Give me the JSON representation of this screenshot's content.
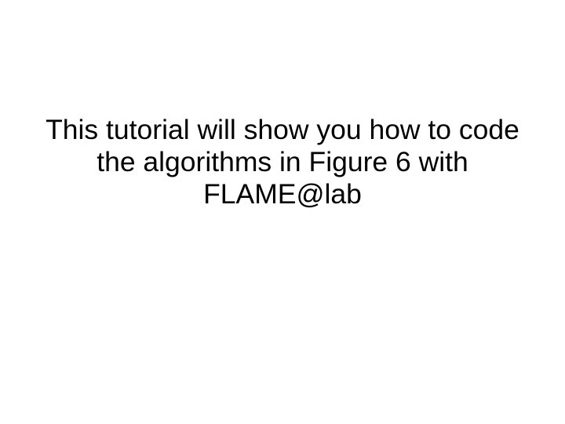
{
  "slide": {
    "body": "This tutorial will show you how to code the algorithms in Figure 6 with FLAME@lab"
  }
}
